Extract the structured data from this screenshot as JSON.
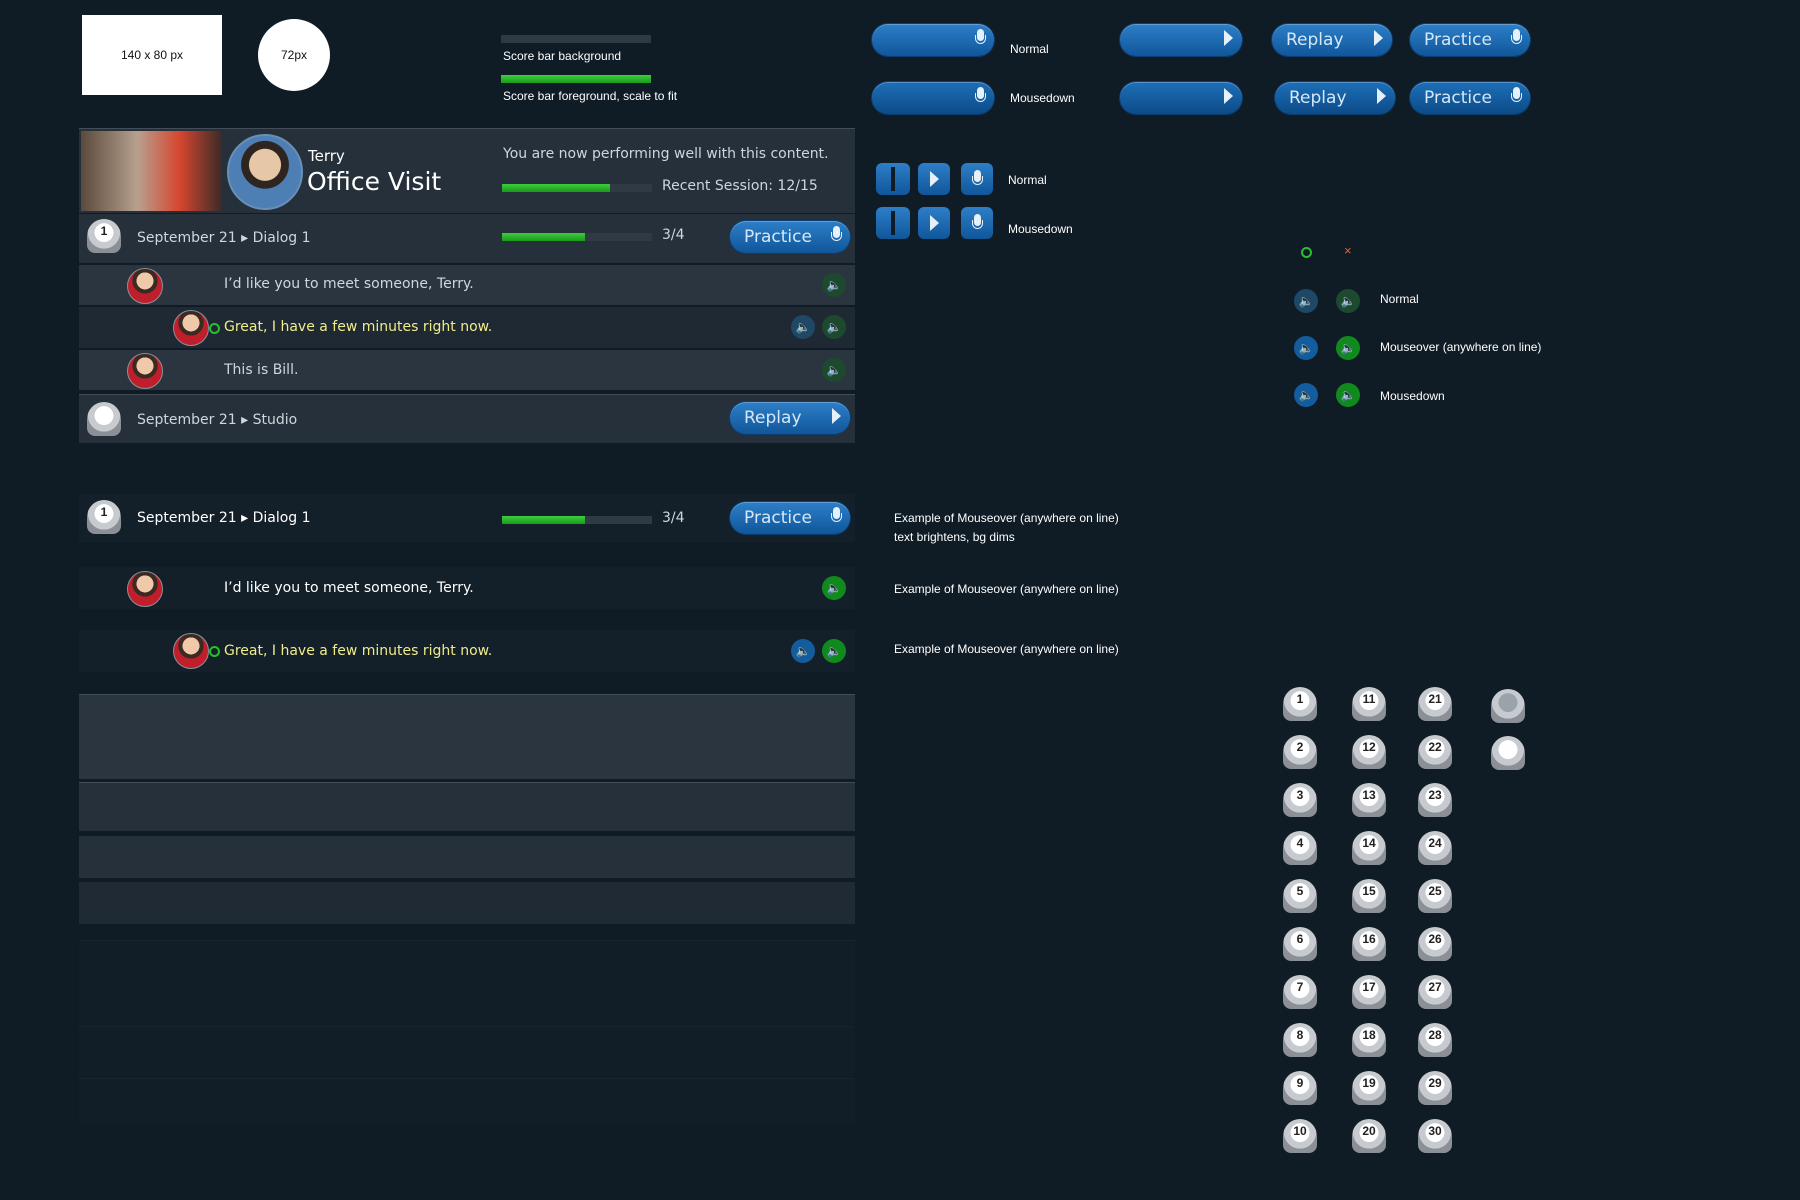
{
  "placeholders": {
    "rect": "140 x 80 px",
    "circle": "72px"
  },
  "score_bars": {
    "bg_label": "Score bar background",
    "fg_label": "Score bar foreground, scale to fit"
  },
  "button_specs": {
    "normal": "Normal",
    "mousedown": "Mousedown",
    "replay": "Replay",
    "practice": "Practice"
  },
  "controls_specs": {
    "normal": "Normal",
    "mousedown": "Mousedown"
  },
  "speaker_specs": {
    "check": "o",
    "cross": "×",
    "normal": "Normal",
    "mouseover": "Mouseover (anywhere on line)",
    "mousedown": "Mousedown"
  },
  "panel": {
    "character": "Terry",
    "title": "Office Visit",
    "status": "You are now performing well with this content.",
    "recent": "Recent Session: 12/15",
    "recent_progress": 0.72,
    "dialog1": {
      "date": "September 21",
      "name": "Dialog 1",
      "score": "3/4",
      "progress": 0.55,
      "button": "Practice"
    },
    "lines": [
      "I’d like you to meet someone, Terry.",
      "Great, I have a few minutes right now.",
      "This is Bill."
    ],
    "studio": {
      "date": "September 21",
      "name": "Studio",
      "button": "Replay"
    }
  },
  "example": {
    "dialog": {
      "date": "September 21",
      "name": "Dialog 1",
      "score": "3/4",
      "progress": 0.55,
      "button": "Practice"
    },
    "lines": [
      "I’d like you to meet someone, Terry.",
      "Great, I have a few minutes right now."
    ],
    "note1a": "Example of Mouseover (anywhere on line)",
    "note1b": "text brightens, bg dims",
    "note2": "Example of Mouseover (anywhere on line)",
    "note3": "Example of Mouseover (anywhere on line)"
  },
  "badges": [
    "1",
    "2",
    "3",
    "4",
    "5",
    "6",
    "7",
    "8",
    "9",
    "10",
    "11",
    "12",
    "13",
    "14",
    "15",
    "16",
    "17",
    "18",
    "19",
    "20",
    "21",
    "22",
    "23",
    "24",
    "25",
    "26",
    "27",
    "28",
    "29",
    "30"
  ],
  "colors": {
    "bg": "#0f1b25",
    "accent_blue": "#1a6ab0",
    "green": "#2ab52a",
    "highlight_text": "#f0ec8a"
  }
}
